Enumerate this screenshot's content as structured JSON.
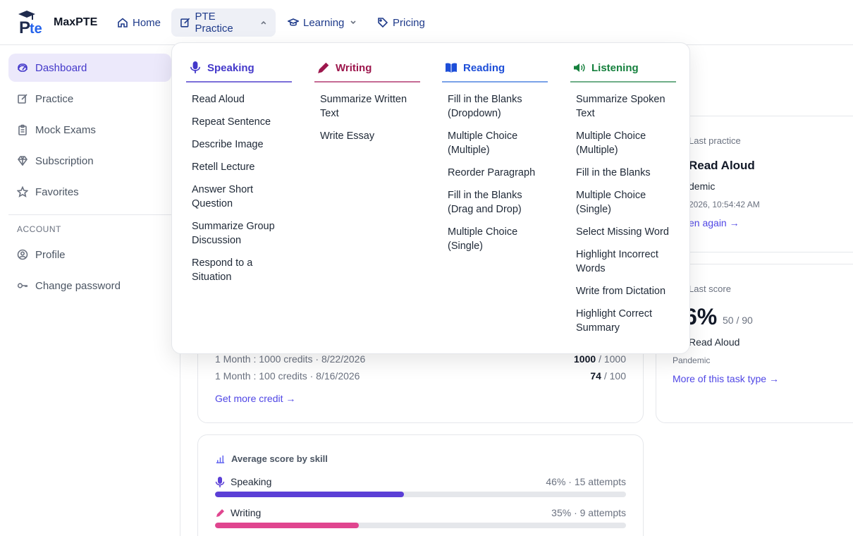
{
  "brand": {
    "name": "MaxPTE",
    "logo_letters": "Pte"
  },
  "nav": {
    "home": "Home",
    "pte_practice": "PTE Practice",
    "learning": "Learning",
    "pricing": "Pricing"
  },
  "sidebar": {
    "items": [
      {
        "label": "Dashboard",
        "icon": "gauge-icon"
      },
      {
        "label": "Practice",
        "icon": "edit-icon"
      },
      {
        "label": "Mock Exams",
        "icon": "clipboard-icon"
      },
      {
        "label": "Subscription",
        "icon": "diamond-icon"
      },
      {
        "label": "Favorites",
        "icon": "star-icon"
      }
    ],
    "section_label": "ACCOUNT",
    "account_items": [
      {
        "label": "Profile",
        "icon": "user-circle-icon"
      },
      {
        "label": "Change password",
        "icon": "key-icon"
      }
    ]
  },
  "mega_menu": {
    "columns": [
      {
        "title": "Speaking",
        "color": "#4338ca",
        "items": [
          "Read Aloud",
          "Repeat Sentence",
          "Describe Image",
          "Retell Lecture",
          "Answer Short Question",
          "Summarize Group Discussion",
          "Respond to a Situation"
        ]
      },
      {
        "title": "Writing",
        "color": "#9d174d",
        "items": [
          "Summarize Written Text",
          "Write Essay"
        ]
      },
      {
        "title": "Reading",
        "color": "#1d4ed8",
        "items": [
          "Fill in the Blanks (Dropdown)",
          "Multiple Choice (Multiple)",
          "Reorder Paragraph",
          "Fill in the Blanks (Drag and Drop)",
          "Multiple Choice (Single)"
        ]
      },
      {
        "title": "Listening",
        "color": "#15803d",
        "items": [
          "Summarize Spoken Text",
          "Multiple Choice (Multiple)",
          "Fill in the Blanks",
          "Multiple Choice (Single)",
          "Select Missing Word",
          "Highlight Incorrect Words",
          "Write from Dictation",
          "Highlight Correct Summary"
        ]
      }
    ]
  },
  "credits": {
    "rows": [
      {
        "label": "1 Month : 1000 credits · 8/22/2026",
        "used": "1000",
        "total": "/ 1000"
      },
      {
        "label": "1 Month : 100 credits · 8/16/2026",
        "used": "74",
        "total": "/ 100"
      }
    ],
    "link": "Get more credit →"
  },
  "last_practice": {
    "label": "Last practice",
    "task": "Read Aloud",
    "topic": "demic",
    "time": "2026, 10:54:42 AM",
    "link": "en again →"
  },
  "last_score": {
    "label": "Last score",
    "score": "6%",
    "raw": "50 / 90",
    "task": "Read Aloud",
    "topic": "Pandemic",
    "link": "More of this task type →"
  },
  "avg_skill": {
    "title": "Average score by skill",
    "skills": [
      {
        "name": "Speaking",
        "stat": "46% · 15 attempts",
        "pct": 46,
        "color": "#5b3fd6"
      },
      {
        "name": "Writing",
        "stat": "35% · 9 attempts",
        "pct": 35,
        "color": "#e0458f"
      }
    ]
  }
}
